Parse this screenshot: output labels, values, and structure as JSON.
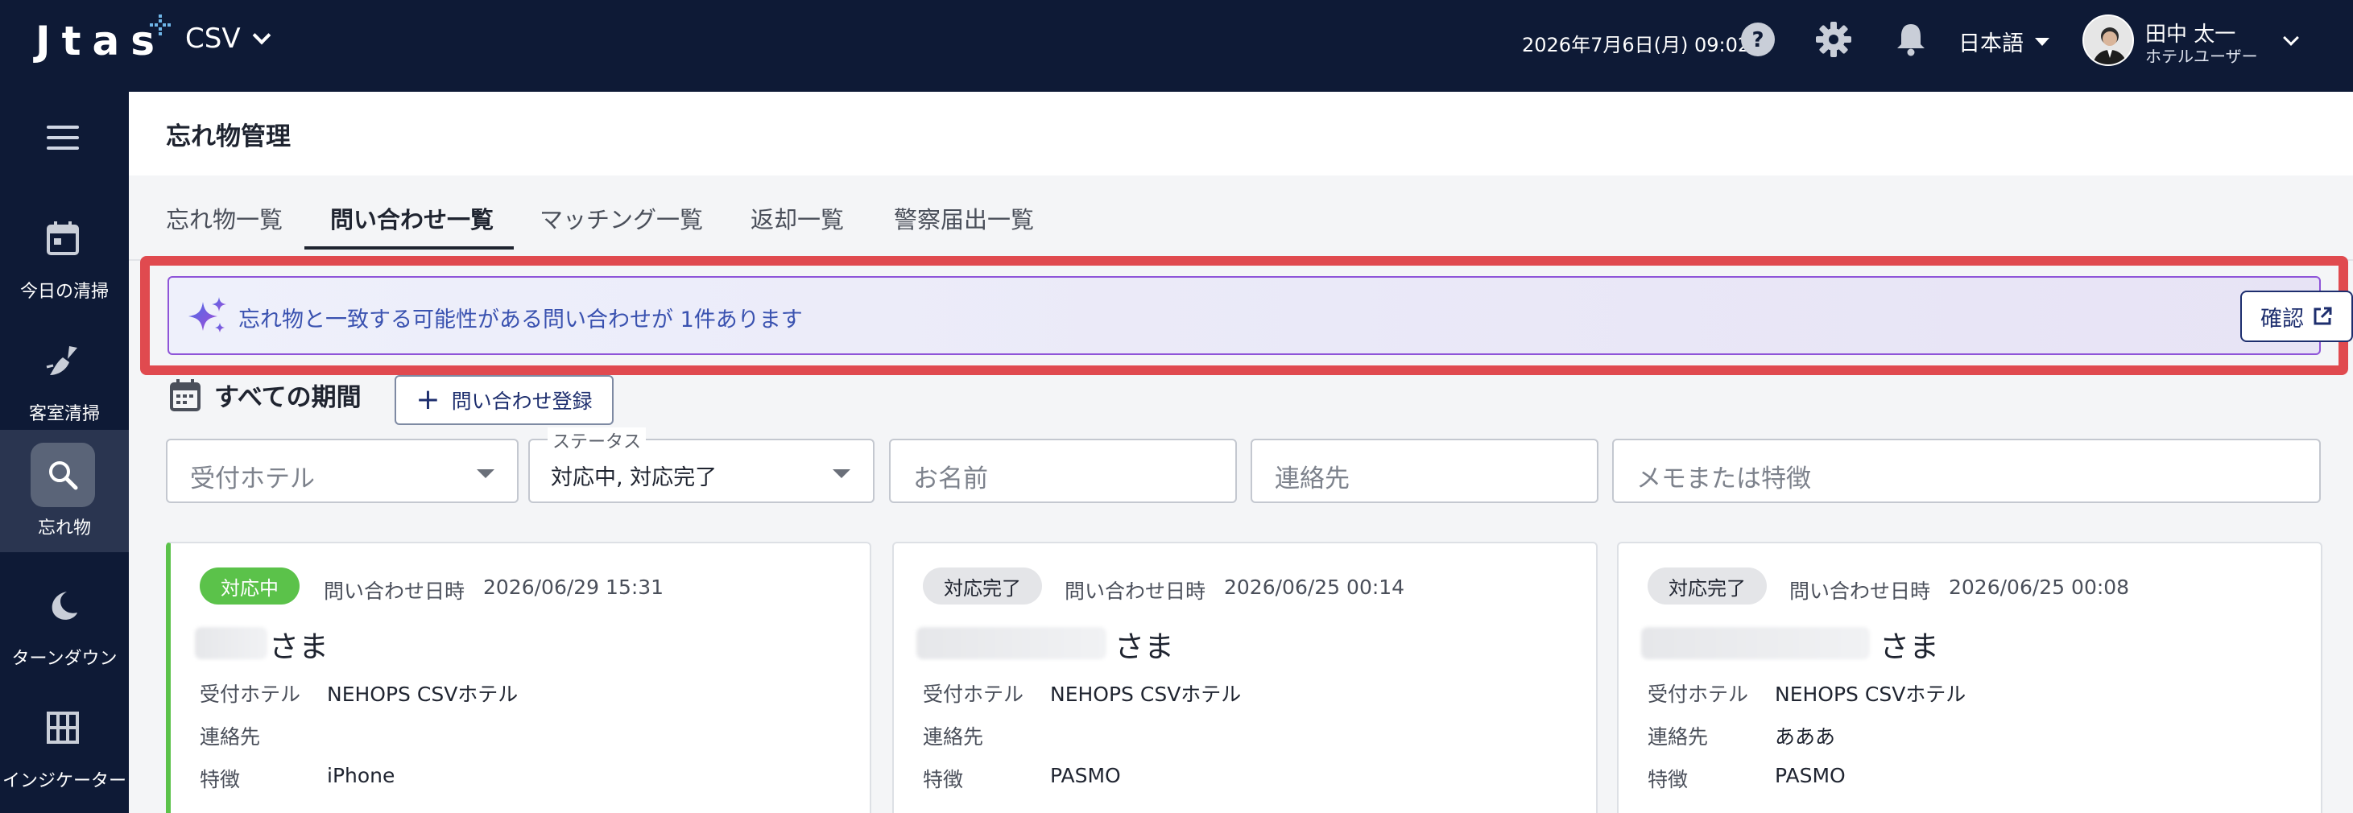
{
  "header": {
    "logo": "Jtas",
    "app_name": "CSV",
    "datetime": "2026年7月6日(月) 09:02",
    "language": "日本語",
    "user_name": "田中 太一",
    "user_role": "ホテルユーザー",
    "icons": [
      "help-icon",
      "gear-icon",
      "bell-icon"
    ]
  },
  "sidebar": {
    "items": [
      {
        "label": "今日の清掃",
        "icon": "calendar-icon"
      },
      {
        "label": "客室清掃",
        "icon": "broom-icon"
      },
      {
        "label": "忘れ物",
        "icon": "search-icon"
      },
      {
        "label": "ターンダウン",
        "icon": "moon-icon"
      },
      {
        "label": "インジケーター",
        "icon": "grid-icon"
      }
    ],
    "active_index": 2
  },
  "page": {
    "title": "忘れ物管理",
    "tabs": [
      "忘れ物一覧",
      "問い合わせ一覧",
      "マッチング一覧",
      "返却一覧",
      "警察届出一覧"
    ],
    "active_tab": 1
  },
  "notification": {
    "text": "忘れ物と一致する可能性がある問い合わせが 1件あります",
    "button": "確認",
    "accent": "#8f55d8",
    "highlight": "#e04a4f"
  },
  "period": {
    "title": "すべての期間",
    "add_button": "問い合わせ登録"
  },
  "filters": {
    "hotel_placeholder": "受付ホテル",
    "status_label": "ステータス",
    "status_value": "対応中, 対応完了",
    "name_placeholder": "お名前",
    "contact_placeholder": "連絡先",
    "memo_placeholder": "メモまたは特徴"
  },
  "cards": [
    {
      "status": "対応中",
      "inquiry_label": "問い合わせ日時",
      "inquiry_date": "2026/06/29 15:31",
      "honorific": "さま",
      "hotel_label": "受付ホテル",
      "hotel": "NEHOPS CSVホテル",
      "contact_label": "連絡先",
      "contact": "",
      "feature_label": "特徴",
      "feature": "iPhone"
    },
    {
      "status": "対応完了",
      "inquiry_label": "問い合わせ日時",
      "inquiry_date": "2026/06/25 00:14",
      "honorific": "さま",
      "hotel_label": "受付ホテル",
      "hotel": "NEHOPS CSVホテル",
      "contact_label": "連絡先",
      "contact": "",
      "feature_label": "特徴",
      "feature": "PASMO"
    },
    {
      "status": "対応完了",
      "inquiry_label": "問い合わせ日時",
      "inquiry_date": "2026/06/25 00:08",
      "honorific": "さま",
      "hotel_label": "受付ホテル",
      "hotel": "NEHOPS CSVホテル",
      "contact_label": "連絡先",
      "contact": "あああ",
      "feature_label": "特徴",
      "feature": "PASMO"
    }
  ],
  "colors": {
    "nav_bg": "#0e1a36",
    "status_active": "#5bc24a",
    "primary": "#1d2e6e"
  }
}
